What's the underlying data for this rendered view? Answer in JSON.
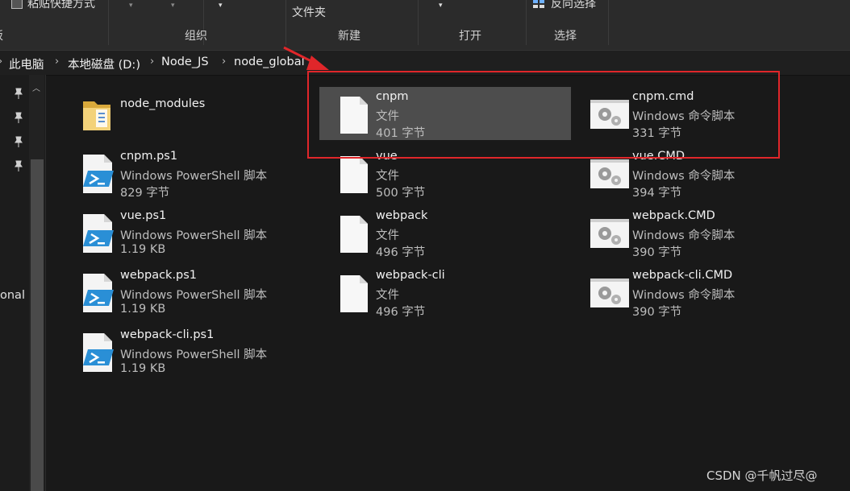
{
  "ribbon": {
    "partial_top_label": "粘贴快捷方式",
    "folder_label": "文件夹",
    "select_all_label": "反向选择",
    "groups": [
      "板",
      "组织",
      "新建",
      "打开",
      "选择"
    ]
  },
  "breadcrumb": [
    "此电脑",
    "本地磁盘 (D:)",
    "Node_JS",
    "node_global"
  ],
  "nav": {
    "cut_text": "onal"
  },
  "files": [
    {
      "name": "node_modules",
      "type": "",
      "size": "",
      "icon": "folder-icon"
    },
    {
      "name": "cnpm",
      "type": "文件",
      "size": "401 字节",
      "icon": "blank-file-icon",
      "selected": true
    },
    {
      "name": "cnpm.cmd",
      "type": "Windows 命令脚本",
      "size": "331 字节",
      "icon": "cmd-gears-icon"
    },
    {
      "name": "cnpm.ps1",
      "type": "Windows PowerShell 脚本",
      "size": "829 字节",
      "icon": "powershell-icon"
    },
    {
      "name": "vue",
      "type": "文件",
      "size": "500 字节",
      "icon": "blank-file-icon"
    },
    {
      "name": "vue.CMD",
      "type": "Windows 命令脚本",
      "size": "394 字节",
      "icon": "cmd-gears-icon"
    },
    {
      "name": "vue.ps1",
      "type": "Windows PowerShell 脚本",
      "size": "1.19 KB",
      "icon": "powershell-icon"
    },
    {
      "name": "webpack",
      "type": "文件",
      "size": "496 字节",
      "icon": "blank-file-icon"
    },
    {
      "name": "webpack.CMD",
      "type": "Windows 命令脚本",
      "size": "390 字节",
      "icon": "cmd-gears-icon"
    },
    {
      "name": "webpack.ps1",
      "type": "Windows PowerShell 脚本",
      "size": "1.19 KB",
      "icon": "powershell-icon"
    },
    {
      "name": "webpack-cli",
      "type": "文件",
      "size": "496 字节",
      "icon": "blank-file-icon"
    },
    {
      "name": "webpack-cli.CMD",
      "type": "Windows 命令脚本",
      "size": "390 字节",
      "icon": "cmd-gears-icon"
    },
    {
      "name": "webpack-cli.ps1",
      "type": "Windows PowerShell 脚本",
      "size": "1.19 KB",
      "icon": "powershell-icon"
    }
  ],
  "watermark": "CSDN @千帆过尽@",
  "colors": {
    "selection": "#4d4d4d",
    "annotation": "#e0262a",
    "background": "#191919"
  }
}
